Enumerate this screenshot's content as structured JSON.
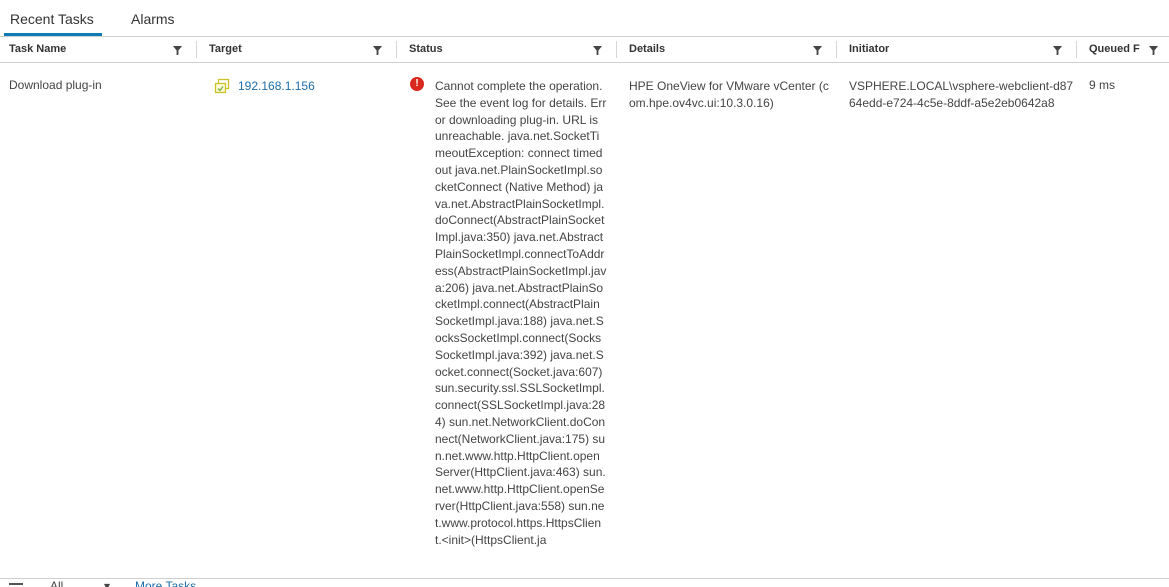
{
  "tabs": [
    {
      "label": "Recent Tasks",
      "active": true
    },
    {
      "label": "Alarms",
      "active": false
    }
  ],
  "columns": [
    {
      "label": "Task Name"
    },
    {
      "label": "Target"
    },
    {
      "label": "Status"
    },
    {
      "label": "Details"
    },
    {
      "label": "Initiator"
    },
    {
      "label": "Queued F"
    }
  ],
  "rows": [
    {
      "task_name": "Download plug-in",
      "target": "192.168.1.156",
      "status": "Cannot complete the operation. See the event log for details. Error downloading plug-in. URL is unreachable. java.net.SocketTimeoutException: connect timed out java.net.PlainSocketImpl.socketConnect (Native Method) java.net.AbstractPlainSocketImpl.doConnect(AbstractPlainSocketImpl.java:350) java.net.AbstractPlainSocketImpl.connectToAddress(AbstractPlainSocketImpl.java:206) java.net.AbstractPlainSocketImpl.connect(AbstractPlainSocketImpl.java:188) java.net.SocksSocketImpl.connect(SocksSocketImpl.java:392) java.net.Socket.connect(Socket.java:607) sun.security.ssl.SSLSocketImpl.connect(SSLSocketImpl.java:284) sun.net.NetworkClient.doConnect(NetworkClient.java:175) sun.net.www.http.HttpClient.openServer(HttpClient.java:463) sun.net.www.http.HttpClient.openServer(HttpClient.java:558) sun.net.www.protocol.https.HttpsClient.<init>(HttpsClient.ja",
      "details": "HPE OneView for VMware vCenter (com.hpe.ov4vc.ui:10.3.0.16)",
      "initiator": "VSPHERE.LOCAL\\vsphere-webclient-d8764edd-e724-4c5e-8ddf-a5e2eb0642a8",
      "queued": "9 ms"
    }
  ],
  "footer": {
    "all_label": "All",
    "more_label": "More Tasks"
  },
  "colors": {
    "accent": "#0f7bb5",
    "link": "#1d6eab",
    "error": "#d9281d"
  }
}
